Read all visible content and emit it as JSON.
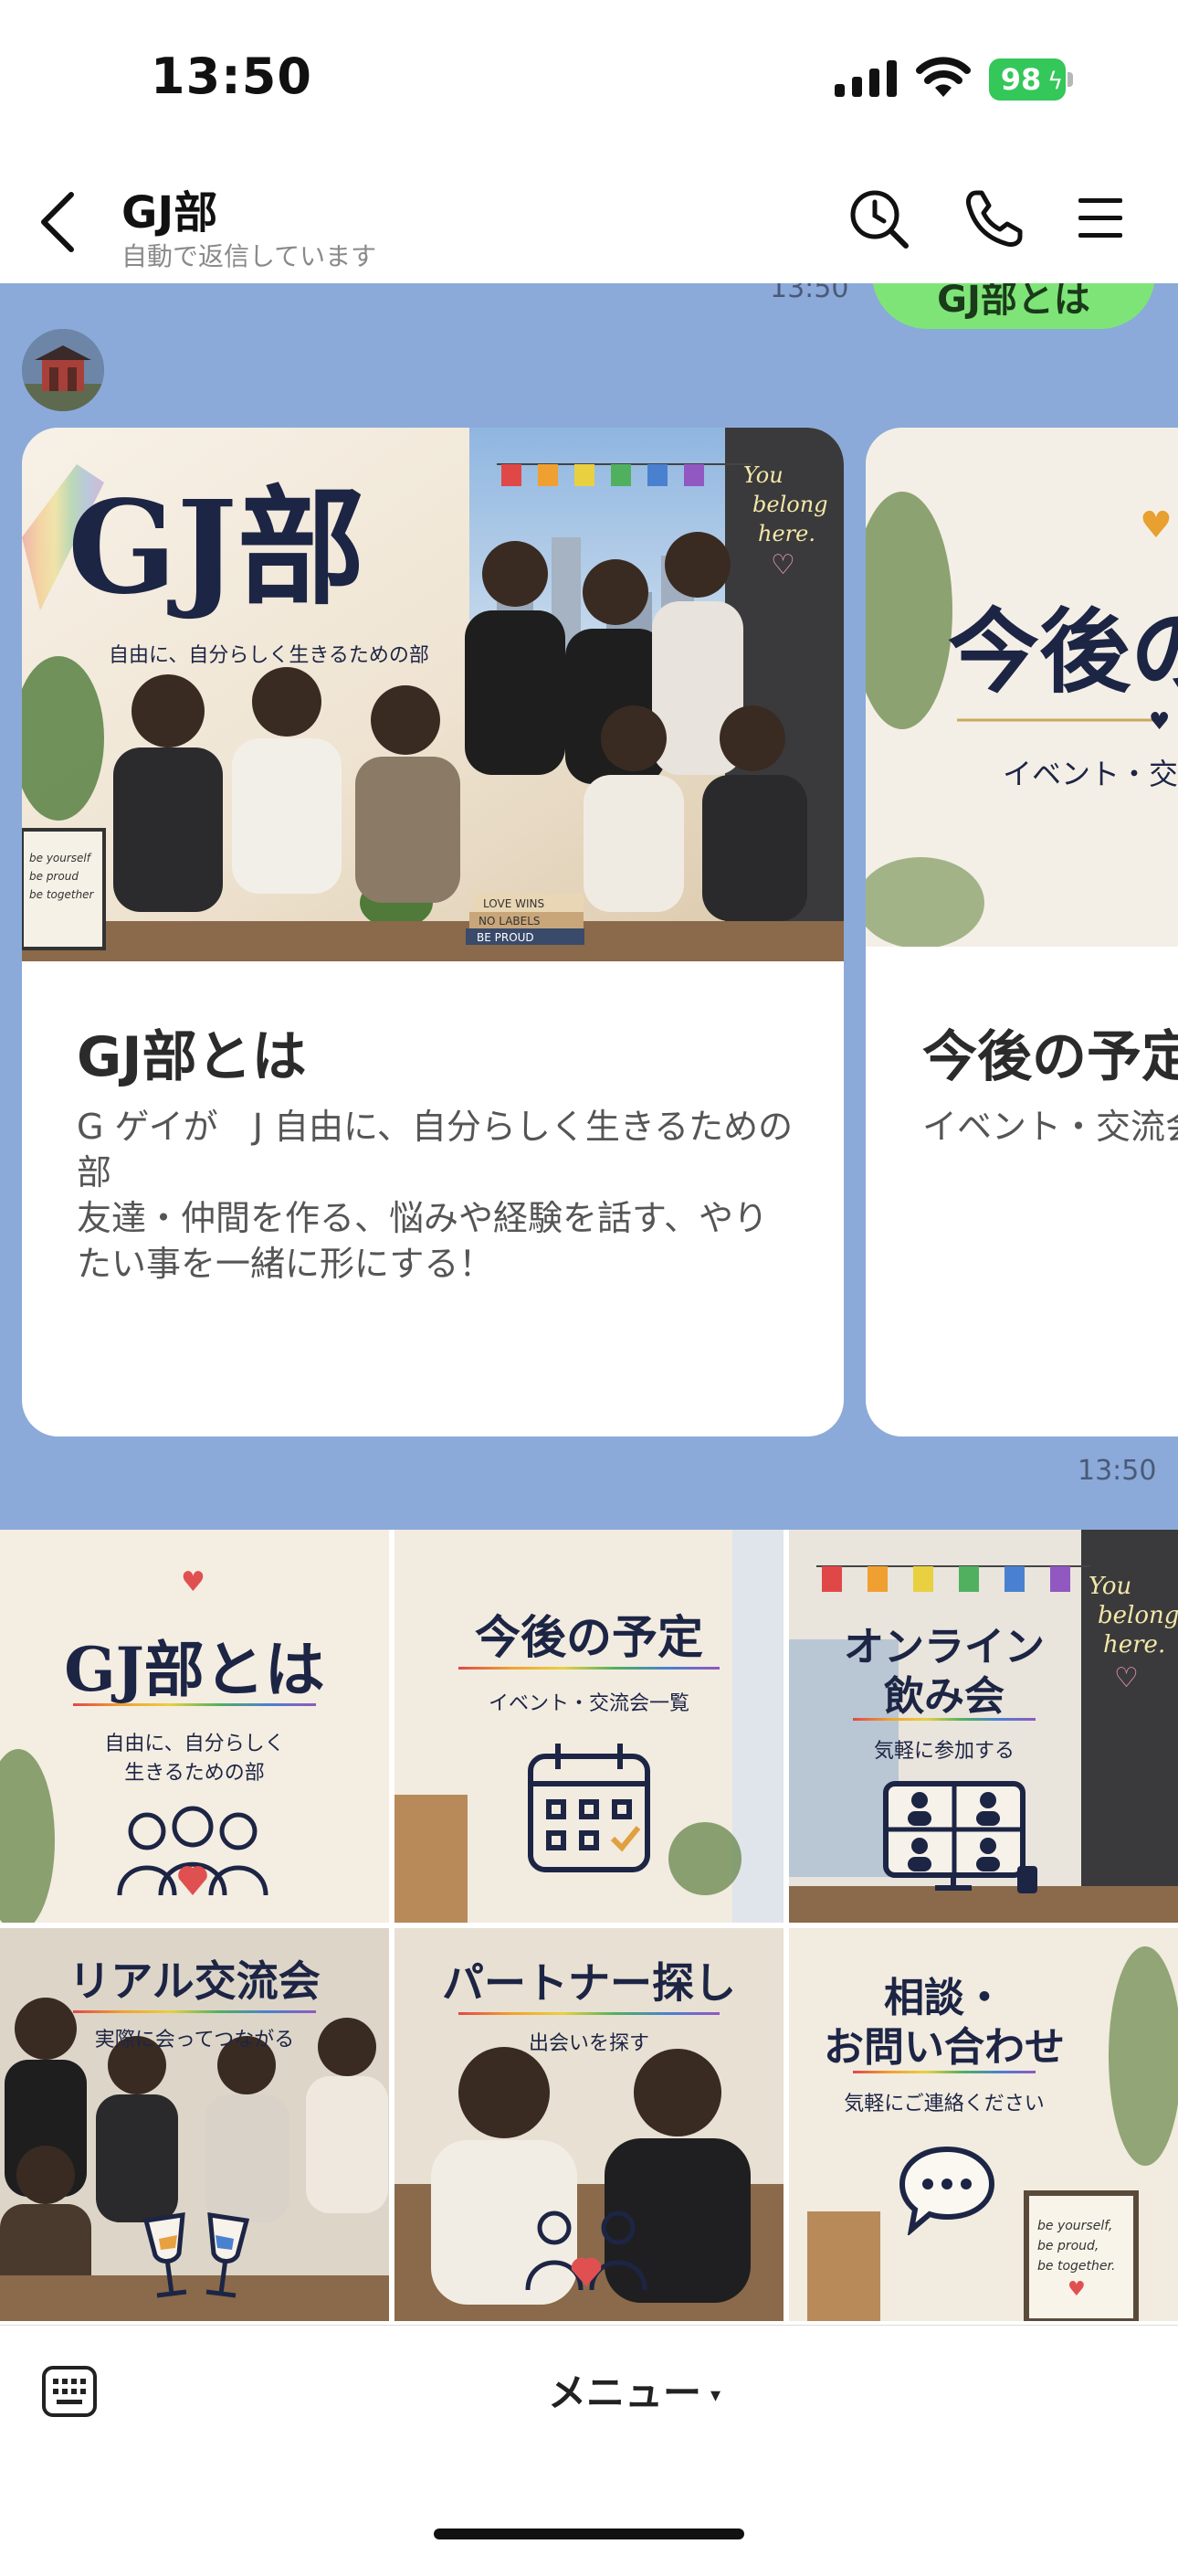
{
  "status_bar": {
    "time": "13:50",
    "battery": "98"
  },
  "header": {
    "title": "GJ部",
    "subtitle": "自動で返信しています",
    "icons": [
      "back-chevron-icon",
      "search-clock-icon",
      "phone-icon",
      "hamburger-menu-icon"
    ]
  },
  "chat": {
    "sent_time": "13:50",
    "sent_text": "GJ部とは",
    "received_time": "13:50",
    "cards": [
      {
        "image": {
          "title": "GJ部",
          "tagline": "自由に、自分らしく生きるための部",
          "neon": [
            "You",
            "belong",
            "here."
          ],
          "books": [
            "LOVE WINS",
            "NO LABELS",
            "BE PROUD"
          ],
          "frame": [
            "be yourself",
            "be proud",
            "be together"
          ]
        },
        "title": "GJ部とは",
        "description": [
          "G ゲイが　J 自由に、自分らしく生きるための部",
          "友達・仲間を作る、悩みや経験を話す、やりたい事を一緒に形にする！"
        ]
      },
      {
        "image": {
          "title": "今後の",
          "tagline": "イベント・交"
        },
        "title": "今後の予定",
        "description": [
          "イベント・交流会"
        ]
      }
    ]
  },
  "rich_menu": {
    "tiles": [
      {
        "heading": "GJ部とは",
        "subtitle_lines": [
          "自由に、自分らしく",
          "生きるための部"
        ],
        "icon": "people-icon"
      },
      {
        "heading": "今後の予定",
        "subtitle_lines": [
          "イベント・交流会一覧"
        ],
        "icon": "calendar-icon"
      },
      {
        "heading_lines": [
          "オンライン",
          "飲み会"
        ],
        "subtitle_lines": [
          "気軽に参加する"
        ],
        "icon": "video-call-icon",
        "neon": [
          "You",
          "belong",
          "here."
        ]
      },
      {
        "heading": "リアル交流会",
        "subtitle_lines": [
          "実際に会ってつながる"
        ],
        "icon": "cheers-icon"
      },
      {
        "heading": "パートナー探し",
        "subtitle_lines": [
          "出会いを探す"
        ],
        "icon": "couple-icon"
      },
      {
        "heading_lines": [
          "相談・",
          "お問い合わせ"
        ],
        "subtitle_lines": [
          "気軽にご連絡ください"
        ],
        "icon": "speech-bubble-icon",
        "frame": [
          "be yourself,",
          "be proud,",
          "be together."
        ]
      }
    ]
  },
  "bottom_bar": {
    "menu_label": "メニュー",
    "arrow": "▾"
  }
}
